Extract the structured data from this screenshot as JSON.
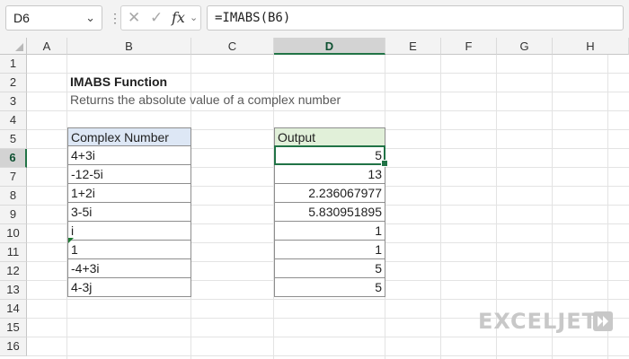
{
  "namebox": {
    "value": "D6"
  },
  "formula_bar": {
    "fx_label": "fx",
    "formula": "=IMABS(B6)"
  },
  "columns": [
    "A",
    "B",
    "C",
    "D",
    "E",
    "F",
    "G",
    "H"
  ],
  "rows": [
    "1",
    "2",
    "3",
    "4",
    "5",
    "6",
    "7",
    "8",
    "9",
    "10",
    "11",
    "12",
    "13",
    "14",
    "15",
    "16"
  ],
  "active_cell": "D6",
  "sheet": {
    "title": "IMABS Function",
    "subtitle": "Returns the absolute value of a complex number",
    "input_header": "Complex Number",
    "output_header": "Output",
    "inputs": [
      "4+3i",
      "-12-5i",
      "1+2i",
      "3-5i",
      "i",
      "1",
      "-4+3i",
      "4-3j"
    ],
    "outputs": [
      "5",
      "13",
      "2.236067977",
      "5.830951895",
      "1",
      "1",
      "5",
      "5"
    ]
  },
  "logo": {
    "text": "EXCELJET"
  },
  "colors": {
    "accent": "#217346",
    "header_blue": "#dde7f5",
    "header_green": "#e1f0d9"
  }
}
